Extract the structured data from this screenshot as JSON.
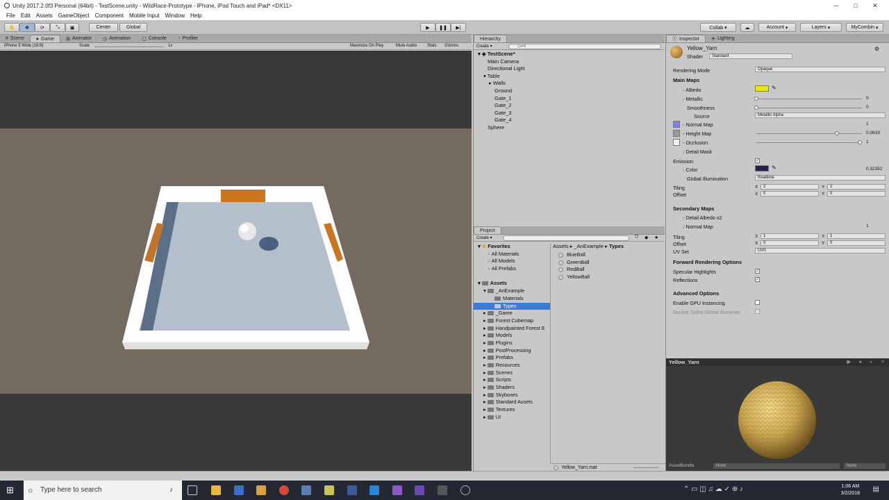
{
  "window": {
    "title": "Unity 2017.2.0f3 Personal (64bit) - TestScene.unity - WildRace-Prototype - iPhone, iPod Touch and iPad* <DX11>",
    "minimize": "─",
    "maximize": "□",
    "close": "✕"
  },
  "menu": [
    "File",
    "Edit",
    "Assets",
    "GameObject",
    "Component",
    "Mobile Input",
    "Window",
    "Help"
  ],
  "toolbar": {
    "center": "Center",
    "global": "Global",
    "collab": "Collab ▾",
    "account": "Account",
    "layers": "Layers",
    "layout": "MyCombin"
  },
  "game_tabs": {
    "scene": "Scene",
    "game": "Game",
    "animator": "Animator",
    "animation": "Animation",
    "console": "Console",
    "profiler": "Profiler"
  },
  "game_bar": {
    "resolution": "iPhone 5 Wide (16:9)",
    "scale_label": "Scale",
    "scale_value": "1x",
    "maximize_on_play": "Maximize On Play",
    "mute_audio": "Mute Audio",
    "stats": "Stats",
    "gizmos": "Gizmos"
  },
  "hierarchy": {
    "tab": "Hierarchy",
    "create": "Create ▾",
    "search_placeholder": "Q▾All",
    "items": [
      {
        "label": "TestScene*",
        "level": 0,
        "bold": true
      },
      {
        "label": "Main Camera",
        "level": 1
      },
      {
        "label": "Directional Light",
        "level": 1
      },
      {
        "label": "Table",
        "level": 1
      },
      {
        "label": "Walls",
        "level": 2
      },
      {
        "label": "Ground",
        "level": 2
      },
      {
        "label": "Gate_1",
        "level": 2
      },
      {
        "label": "Gate_2",
        "level": 2
      },
      {
        "label": "Gate_3",
        "level": 2
      },
      {
        "label": "Gate_4",
        "level": 2
      },
      {
        "label": "Sphere",
        "level": 1
      }
    ]
  },
  "project": {
    "tab": "Project",
    "create": "Create ▾",
    "favorites": {
      "label": "Favorites",
      "items": [
        "All Materials",
        "All Models",
        "All Prefabs"
      ]
    },
    "assets_label": "Assets",
    "tree": [
      {
        "label": "_AnExample",
        "level": 1
      },
      {
        "label": "Materials",
        "level": 2
      },
      {
        "label": "Types",
        "level": 2,
        "selected": true
      },
      {
        "label": "_Game",
        "level": 1
      },
      {
        "label": "Forest Cubemap",
        "level": 1
      },
      {
        "label": "Handpainted Forest E",
        "level": 1
      },
      {
        "label": "Models",
        "level": 1
      },
      {
        "label": "Plugins",
        "level": 1
      },
      {
        "label": "PostProcessing",
        "level": 1
      },
      {
        "label": "Prefabs",
        "level": 1
      },
      {
        "label": "Resources",
        "level": 1
      },
      {
        "label": "Scenes",
        "level": 1
      },
      {
        "label": "Scripts",
        "level": 1
      },
      {
        "label": "Shaders",
        "level": 1
      },
      {
        "label": "Skyboxes",
        "level": 1
      },
      {
        "label": "Standard Assets",
        "level": 1
      },
      {
        "label": "Textures",
        "level": 1
      },
      {
        "label": "UI",
        "level": 1
      }
    ],
    "breadcrumb": {
      "a": "Assets",
      "b": "_AnExample",
      "c": "Types",
      "sep": "▸"
    },
    "files": [
      "BlueBall",
      "GreenBall",
      "RedBall",
      "YellowBall"
    ],
    "footer": "Yellow_Yarn.mat"
  },
  "inspector": {
    "tab": "Inspector",
    "tab2": "Lighting",
    "material_name": "Yellow_Yarn",
    "shader_label": "Shader",
    "shader_value": "Standard",
    "rendering_mode_label": "Rendering Mode",
    "rendering_mode_value": "Opaque",
    "main_maps": "Main Maps",
    "albedo": "Albedo",
    "metallic": "Metallic",
    "metallic_value": "0",
    "smoothness": "Smoothness",
    "smoothness_value": "0",
    "source": "Source",
    "source_value": "Metallic Alpha",
    "normal_map": "Normal Map",
    "normal_value": "1",
    "height_map": "Height Map",
    "height_value": "0.0633",
    "occlusion": "Occlusion",
    "occlusion_value": "1",
    "detail_mask": "Detail Mask",
    "emission": "Emission",
    "color": "Color",
    "color_value": "0.32352",
    "global_illumination": "Global Illumination",
    "gi_value": "Realtime",
    "tiling": "Tiling",
    "tiling_x": "2",
    "tiling_y": "2",
    "offset": "Offset",
    "offset_x": "0",
    "offset_y": "0",
    "x": "X",
    "y": "Y",
    "secondary_maps": "Secondary Maps",
    "detail_albedo": "Detail Albedo x2",
    "normal_map2": "Normal Map",
    "normal2_value": "1",
    "tiling2": "Tiling",
    "tiling2_x": "1",
    "tiling2_y": "1",
    "offset2": "Offset",
    "offset2_x": "0",
    "offset2_y": "0",
    "uv_set": "UV Set",
    "uv_set_value": "UV0",
    "forward_options": "Forward Rendering Options",
    "specular": "Specular Highlights",
    "reflections": "Reflections",
    "advanced": "Advanced Options",
    "gpu_instancing": "Enable GPU Instancing",
    "double_sided": "Double Sided Global Illuminati",
    "preview_title": "Yellow_Yarn",
    "assetbundle": "AssetBundle",
    "assetbundle_value": "None",
    "assetbundle_variant": "None",
    "albedo_color": "#f2e600",
    "emission_color": "#2a1a52"
  },
  "taskbar": {
    "search": "Type here to search",
    "time": "1:06 AM",
    "date": "3/2/2018"
  }
}
